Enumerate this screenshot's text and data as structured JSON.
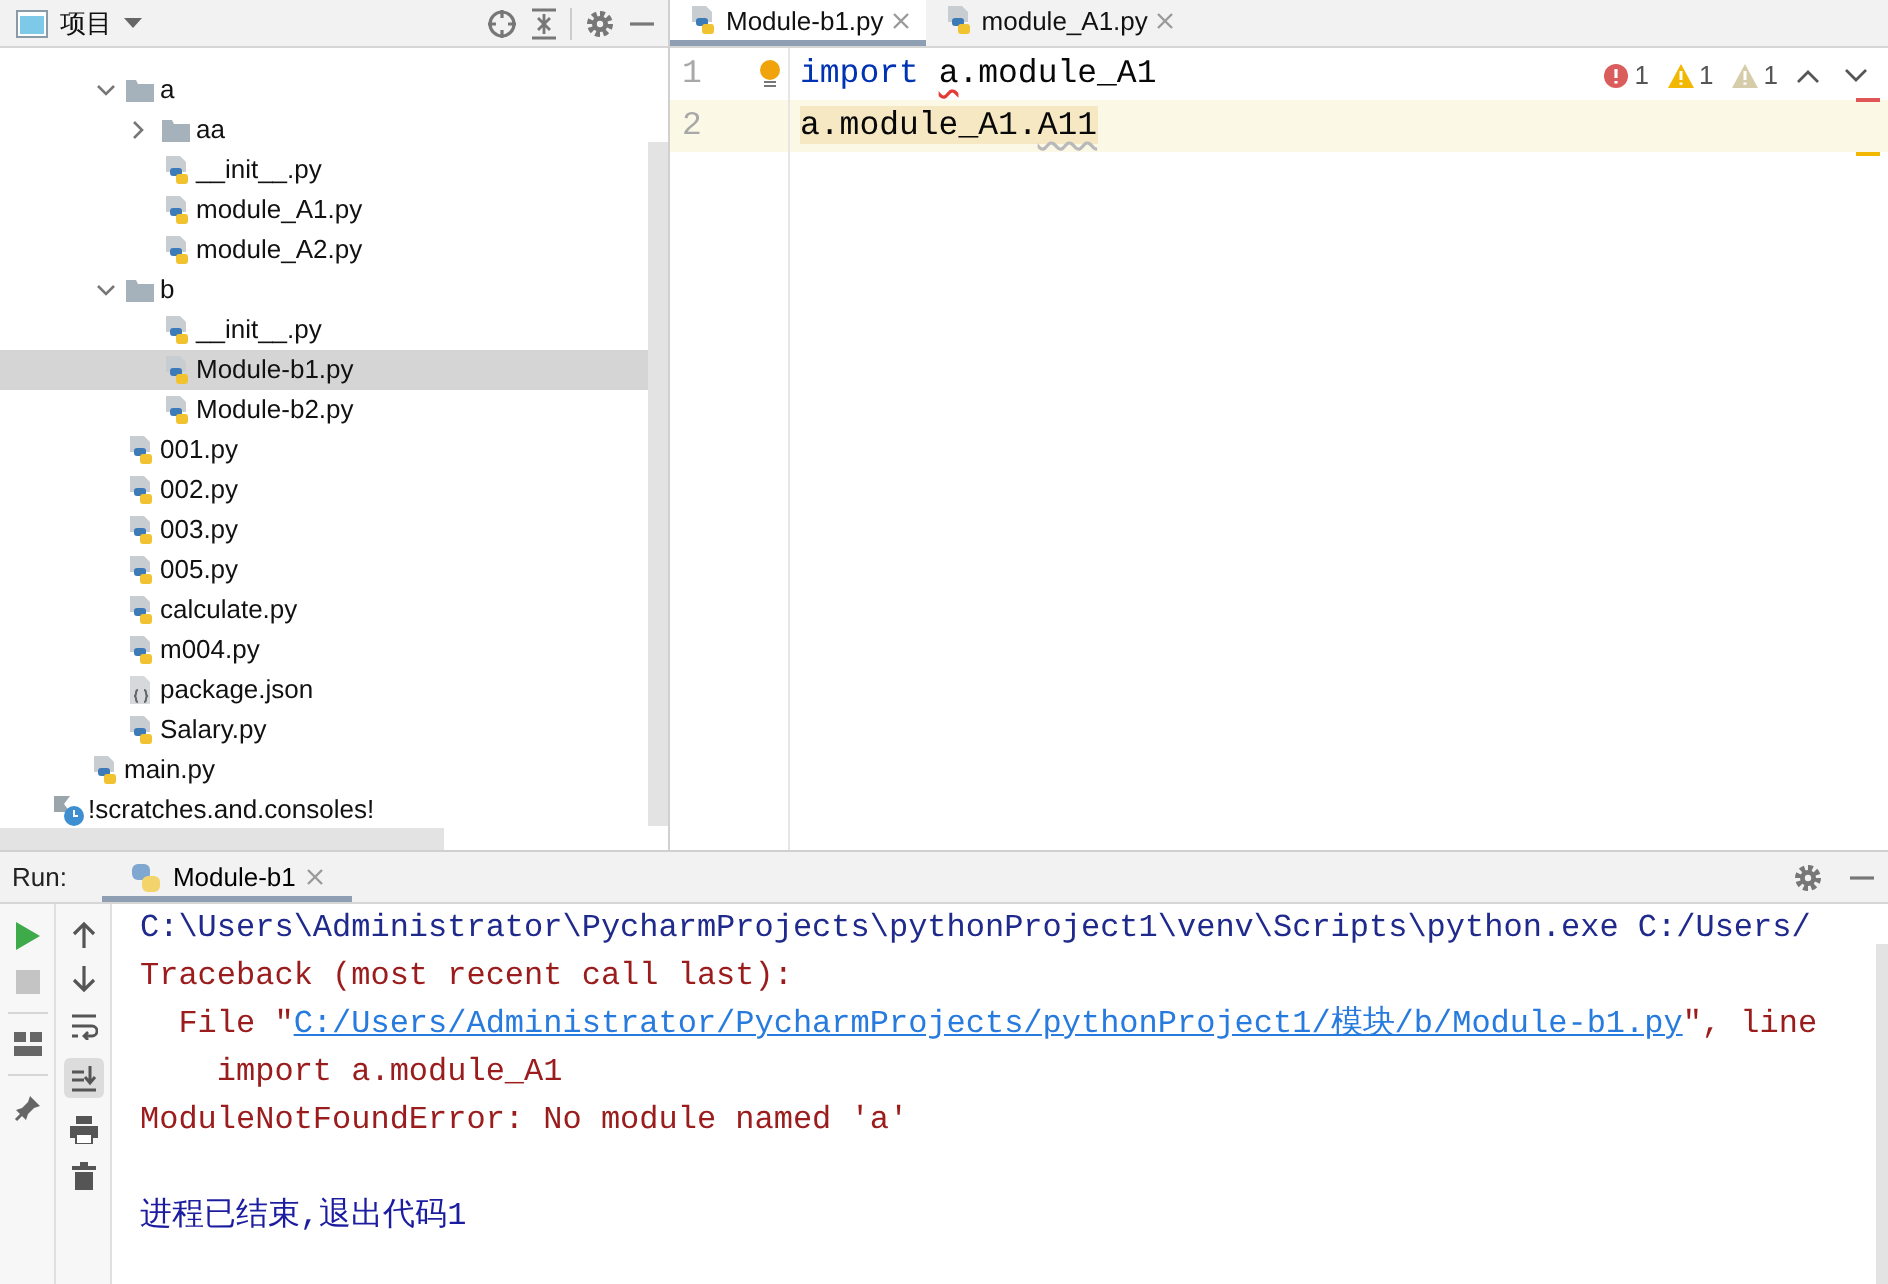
{
  "project_panel": {
    "title": "项目",
    "tree": [
      {
        "children": [
          {
            "label": "a",
            "kind": "folder",
            "expanded": true,
            "selected": false,
            "children": [
              {
                "label": "aa",
                "kind": "folder",
                "expanded": false,
                "selected": false
              },
              {
                "label": "__init__.py",
                "kind": "python",
                "selected": false
              },
              {
                "label": "module_A1.py",
                "kind": "python",
                "selected": false
              },
              {
                "label": "module_A2.py",
                "kind": "python",
                "selected": false
              }
            ]
          },
          {
            "label": "b",
            "kind": "folder",
            "expanded": true,
            "selected": false,
            "children": [
              {
                "label": "__init__.py",
                "kind": "python",
                "selected": false
              },
              {
                "label": "Module-b1.py",
                "kind": "python",
                "selected": true
              },
              {
                "label": "Module-b2.py",
                "kind": "python",
                "selected": false
              }
            ]
          },
          {
            "label": "001.py",
            "kind": "python",
            "selected": false
          },
          {
            "label": "002.py",
            "kind": "python",
            "selected": false
          },
          {
            "label": "003.py",
            "kind": "python",
            "selected": false
          },
          {
            "label": "005.py",
            "kind": "python",
            "selected": false
          },
          {
            "label": "calculate.py",
            "kind": "python",
            "selected": false
          },
          {
            "label": "m004.py",
            "kind": "python",
            "selected": false
          },
          {
            "label": "package.json",
            "kind": "json",
            "selected": false
          },
          {
            "label": "Salary.py",
            "kind": "python",
            "selected": false
          }
        ]
      },
      {
        "label": "main.py",
        "kind": "python",
        "selected": false
      }
    ],
    "root_items": [
      {
        "label": "!scratches.and.consoles!",
        "kind": "scratches",
        "selected": false
      }
    ]
  },
  "editor": {
    "tabs": [
      {
        "label": "Module-b1.py",
        "selected": true
      },
      {
        "label": "module_A1.py",
        "selected": false
      }
    ],
    "inspections": [
      {
        "kind": "error",
        "count": "1"
      },
      {
        "kind": "warning",
        "count": "1"
      },
      {
        "kind": "weak_warning",
        "count": "1"
      }
    ],
    "lines": [
      {
        "number": "1",
        "current": false,
        "tokens": [
          {
            "text": "import",
            "kind": "keyword"
          },
          {
            "text": "a",
            "kind": "error"
          },
          {
            "text": ".module_A1",
            "kind": "plain"
          }
        ]
      },
      {
        "number": "2",
        "current": true,
        "tokens": [
          {
            "text": "a.module_A1.",
            "kind": "usage"
          },
          {
            "text": "A11",
            "kind": "usage_weak"
          }
        ]
      }
    ]
  },
  "run_panel": {
    "label": "Run:",
    "tab": {
      "label": "Module-b1",
      "selected": true
    },
    "console": [
      {
        "kind": "command",
        "text": "C:\\Users\\Administrator\\PycharmProjects\\pythonProject1\\venv\\Scripts\\python.exe C:/Users/"
      },
      {
        "kind": "stderr",
        "text": "Traceback (most recent call last):"
      },
      {
        "kind": "stderr",
        "text": "  File \"",
        "link": "C:/Users/Administrator/PycharmProjects/pythonProject1/模块/b/Module-b1.py",
        "after": "\", line"
      },
      {
        "kind": "stderr",
        "text": "    import a.module_A1"
      },
      {
        "kind": "stderr",
        "text": "ModuleNotFoundError: No module named 'a'"
      },
      {
        "kind": "exit",
        "text": "进程已结束,退出代码1"
      }
    ]
  }
}
